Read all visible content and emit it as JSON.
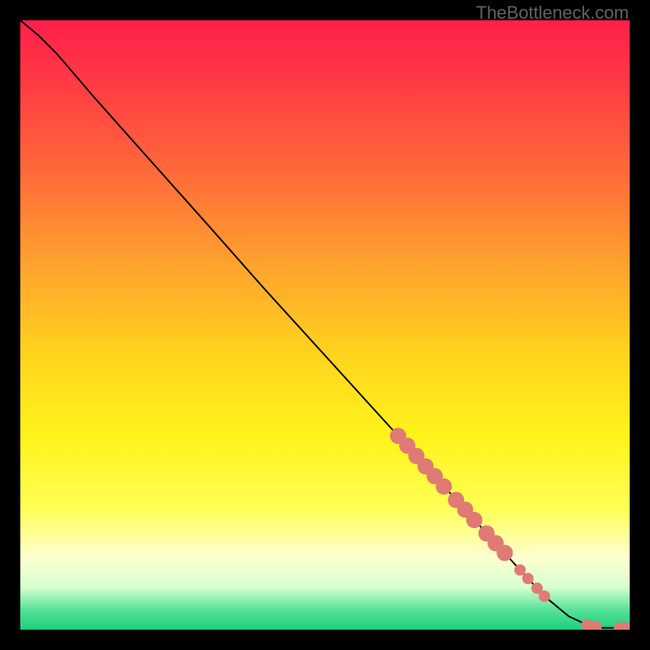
{
  "watermark": "TheBottleneck.com",
  "chart_data": {
    "type": "line",
    "title": "",
    "xlabel": "",
    "ylabel": "",
    "xlim": [
      0,
      100
    ],
    "ylim": [
      0,
      100
    ],
    "background_gradient": {
      "stops": [
        {
          "offset": 0.0,
          "color": "#ff1f4a"
        },
        {
          "offset": 0.1,
          "color": "#ff3a44"
        },
        {
          "offset": 0.25,
          "color": "#ff6a3a"
        },
        {
          "offset": 0.4,
          "color": "#ffa22e"
        },
        {
          "offset": 0.55,
          "color": "#ffd41e"
        },
        {
          "offset": 0.68,
          "color": "#fff31a"
        },
        {
          "offset": 0.8,
          "color": "#ffff55"
        },
        {
          "offset": 0.88,
          "color": "#ffffd0"
        },
        {
          "offset": 0.93,
          "color": "#d7ffd0"
        },
        {
          "offset": 0.97,
          "color": "#4fe095"
        },
        {
          "offset": 1.0,
          "color": "#1ecf80"
        }
      ]
    },
    "series": [
      {
        "name": "curve",
        "type": "line",
        "color": "#000000",
        "points": [
          {
            "x": 0.0,
            "y": 100.0
          },
          {
            "x": 3.0,
            "y": 97.5
          },
          {
            "x": 6.0,
            "y": 94.5
          },
          {
            "x": 9.0,
            "y": 91.0
          },
          {
            "x": 12.0,
            "y": 87.5
          },
          {
            "x": 20.0,
            "y": 78.5
          },
          {
            "x": 30.0,
            "y": 67.3
          },
          {
            "x": 40.0,
            "y": 56.0
          },
          {
            "x": 50.0,
            "y": 45.0
          },
          {
            "x": 60.0,
            "y": 34.0
          },
          {
            "x": 70.0,
            "y": 23.0
          },
          {
            "x": 80.0,
            "y": 12.0
          },
          {
            "x": 86.0,
            "y": 5.5
          },
          {
            "x": 90.0,
            "y": 2.2
          },
          {
            "x": 93.0,
            "y": 0.8
          },
          {
            "x": 95.5,
            "y": 0.3
          },
          {
            "x": 98.0,
            "y": 0.3
          },
          {
            "x": 99.5,
            "y": 0.3
          }
        ]
      },
      {
        "name": "markers",
        "type": "scatter",
        "color": "#e07a74",
        "radius_large": 10,
        "radius_small": 7,
        "points": [
          {
            "x": 62.0,
            "y": 31.8,
            "r": "large"
          },
          {
            "x": 63.5,
            "y": 30.2,
            "r": "large"
          },
          {
            "x": 65.0,
            "y": 28.5,
            "r": "large"
          },
          {
            "x": 66.5,
            "y": 26.8,
            "r": "large"
          },
          {
            "x": 68.0,
            "y": 25.2,
            "r": "large"
          },
          {
            "x": 69.5,
            "y": 23.5,
            "r": "large"
          },
          {
            "x": 71.5,
            "y": 21.3,
            "r": "large"
          },
          {
            "x": 73.0,
            "y": 19.7,
            "r": "large"
          },
          {
            "x": 74.5,
            "y": 18.0,
            "r": "large"
          },
          {
            "x": 76.5,
            "y": 15.8,
            "r": "large"
          },
          {
            "x": 78.0,
            "y": 14.2,
            "r": "large"
          },
          {
            "x": 79.5,
            "y": 12.6,
            "r": "large"
          },
          {
            "x": 82.0,
            "y": 9.8,
            "r": "small"
          },
          {
            "x": 83.3,
            "y": 8.4,
            "r": "small"
          },
          {
            "x": 84.8,
            "y": 6.8,
            "r": "small"
          },
          {
            "x": 86.0,
            "y": 5.5,
            "r": "small"
          },
          {
            "x": 93.0,
            "y": 0.8,
            "r": "small"
          },
          {
            "x": 94.5,
            "y": 0.5,
            "r": "small"
          },
          {
            "x": 98.3,
            "y": 0.3,
            "r": "small"
          },
          {
            "x": 99.5,
            "y": 0.3,
            "r": "small"
          }
        ]
      }
    ]
  }
}
